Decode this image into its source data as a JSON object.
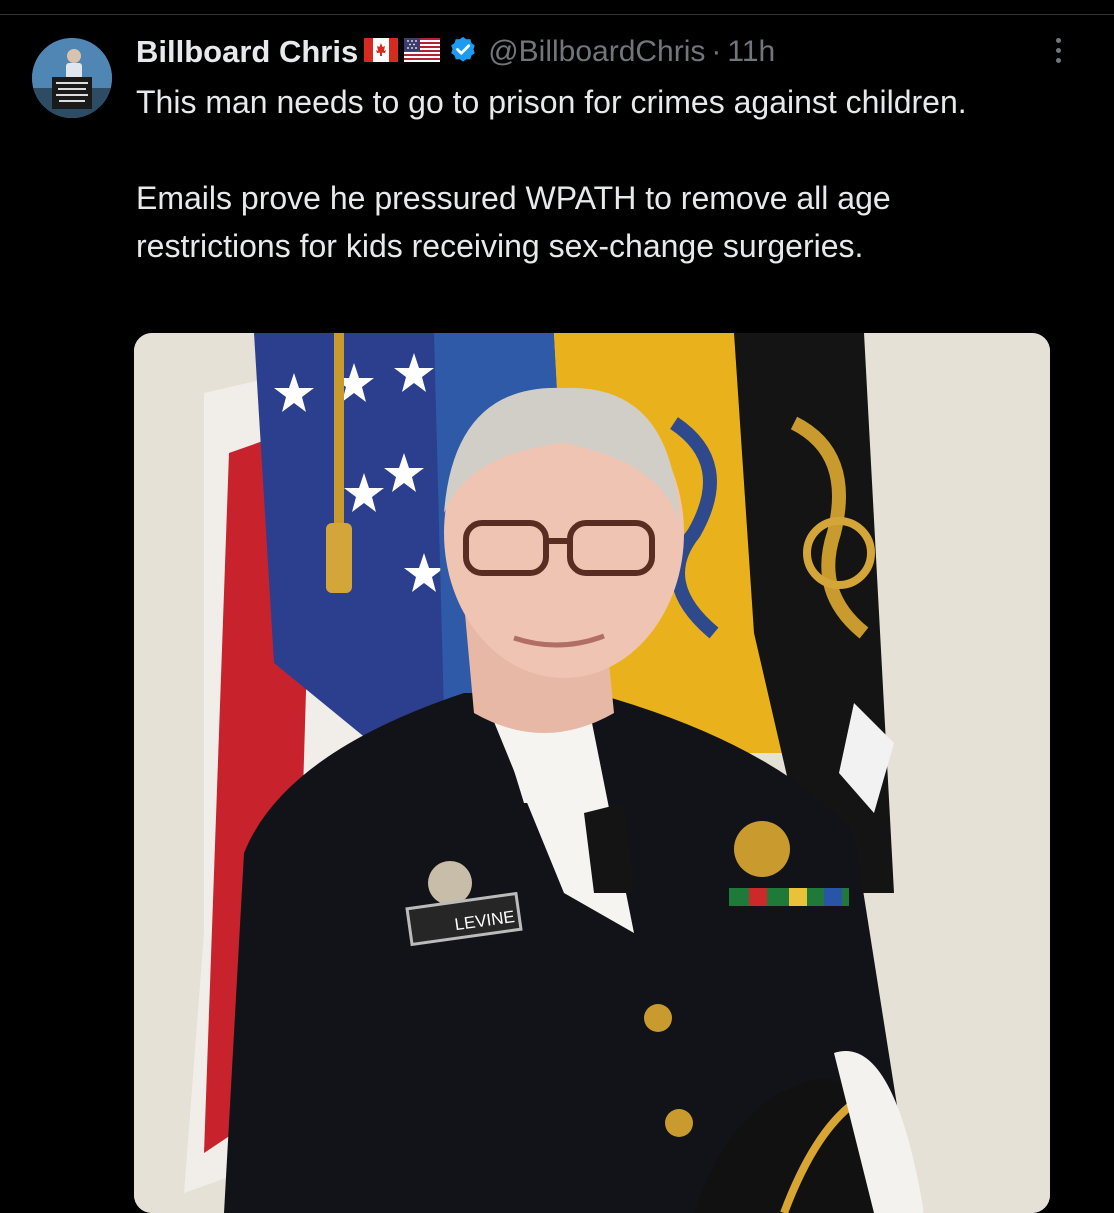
{
  "tweet": {
    "author_name": "Billboard Chris",
    "handle": "@BillboardChris",
    "separator": "·",
    "time": "11h",
    "text_paragraph_1": "This man needs to go to prison for crimes against children.",
    "text_paragraph_2": "Emails prove he pressured WPATH to remove all age restrictions for kids receiving sex-change surgeries.",
    "flags": [
      "canada-flag-icon",
      "us-flag-icon"
    ],
    "verified_badge": "verified-badge-icon",
    "media": {
      "nameplate_text": "LEVINE"
    }
  },
  "colors": {
    "background": "#000000",
    "primary_text": "#e7e9ea",
    "secondary_text": "#71767b",
    "verified_blue": "#1d9bf0",
    "divider": "#2f3336"
  }
}
